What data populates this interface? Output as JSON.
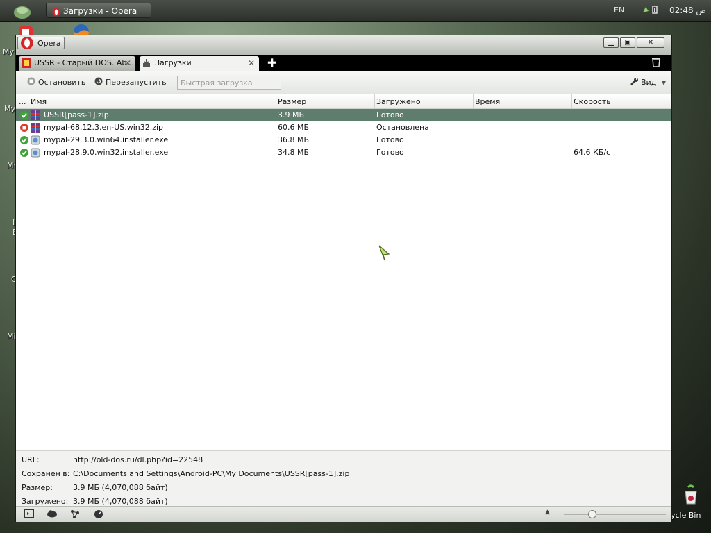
{
  "taskbar": {
    "task_title": "Загрузки - Opera",
    "language": "EN",
    "clock": "02:48 ص"
  },
  "desktop": {
    "labels": [
      "My",
      "My",
      "My",
      "I",
      "E",
      "C",
      "Mi"
    ],
    "recycle_bin": "ycle Bin"
  },
  "window": {
    "app_button": "Opera",
    "tabs": [
      {
        "label": "USSR - Старый DOS. Ab..."
      },
      {
        "label": "Загрузки"
      }
    ]
  },
  "toolbar": {
    "stop_label": "Остановить",
    "restart_label": "Перезапустить",
    "quick_placeholder": "Быстрая загрузка",
    "view_label": "Вид"
  },
  "table": {
    "columns": {
      "dots": "...",
      "name": "Имя",
      "size": "Размер",
      "loaded": "Загружено",
      "time": "Время",
      "speed": "Скорость"
    },
    "rows": [
      {
        "name": "USSR[pass-1].zip",
        "size": "3.9 МБ",
        "status": "Готово",
        "time": "",
        "speed": "",
        "state": "done",
        "file_type": "archive"
      },
      {
        "name": "mypal-68.12.3.en-US.win32.zip",
        "size": "60.6 МБ",
        "status": "Остановлена",
        "time": "",
        "speed": "",
        "state": "stopped",
        "file_type": "archive"
      },
      {
        "name": "mypal-29.3.0.win64.installer.exe",
        "size": "36.8 МБ",
        "status": "Готово",
        "time": "",
        "speed": "",
        "state": "done",
        "file_type": "installer"
      },
      {
        "name": "mypal-28.9.0.win32.installer.exe",
        "size": "34.8 МБ",
        "status": "Готово",
        "time": "",
        "speed": "64.6 КБ/с",
        "state": "done",
        "file_type": "installer"
      }
    ]
  },
  "details": {
    "url_label": "URL:",
    "url_value": "http://old-dos.ru/dl.php?id=22548",
    "saved_label": "Сохранён в:",
    "saved_value": "C:\\Documents and Settings\\Android-PC\\My Documents\\USSR[pass-1].zip",
    "size_label": "Размер:",
    "size_value": "3.9 МБ (4,070,088 байт)",
    "loaded_label": "Загружено:",
    "loaded_value": "3.9 МБ (4,070,088 байт)"
  },
  "colors": {
    "selected_row": "#5e7d6c",
    "done_icon": "#3fa33a",
    "stopped_icon": "#d8402b"
  }
}
